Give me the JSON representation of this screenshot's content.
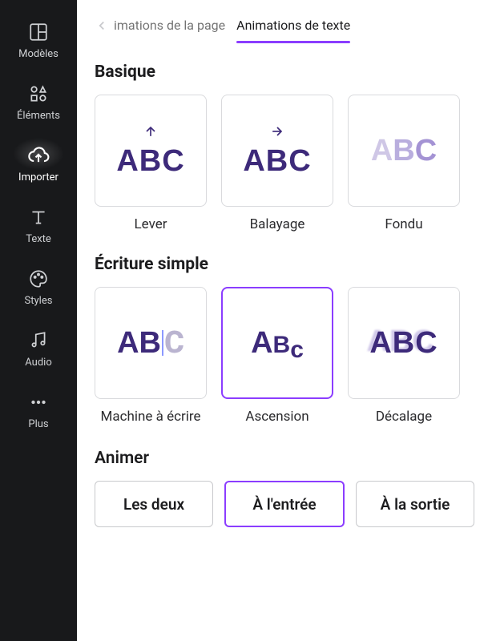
{
  "sidebar": {
    "items": [
      {
        "label": "Modèles"
      },
      {
        "label": "Éléments"
      },
      {
        "label": "Importer"
      },
      {
        "label": "Texte"
      },
      {
        "label": "Styles"
      },
      {
        "label": "Audio"
      },
      {
        "label": "Plus"
      }
    ]
  },
  "tabs": {
    "inactive": "imations de la page",
    "active": "Animations de texte"
  },
  "sections": {
    "basic": {
      "title": "Basique",
      "tiles": [
        {
          "label": "Lever"
        },
        {
          "label": "Balayage"
        },
        {
          "label": "Fondu"
        }
      ]
    },
    "simple": {
      "title": "Écriture simple",
      "tiles": [
        {
          "label": "Machine à écrire"
        },
        {
          "label": "Ascension"
        },
        {
          "label": "Décalage"
        }
      ]
    }
  },
  "animate": {
    "title": "Animer",
    "options": [
      {
        "label": "Les deux"
      },
      {
        "label": "À l'entrée"
      },
      {
        "label": "À la sortie"
      }
    ]
  },
  "colors": {
    "accent": "#8b3dff",
    "text_primary": "#1c1c1e",
    "sidebar_bg": "#18191b",
    "abc": "#3d2a7a"
  }
}
